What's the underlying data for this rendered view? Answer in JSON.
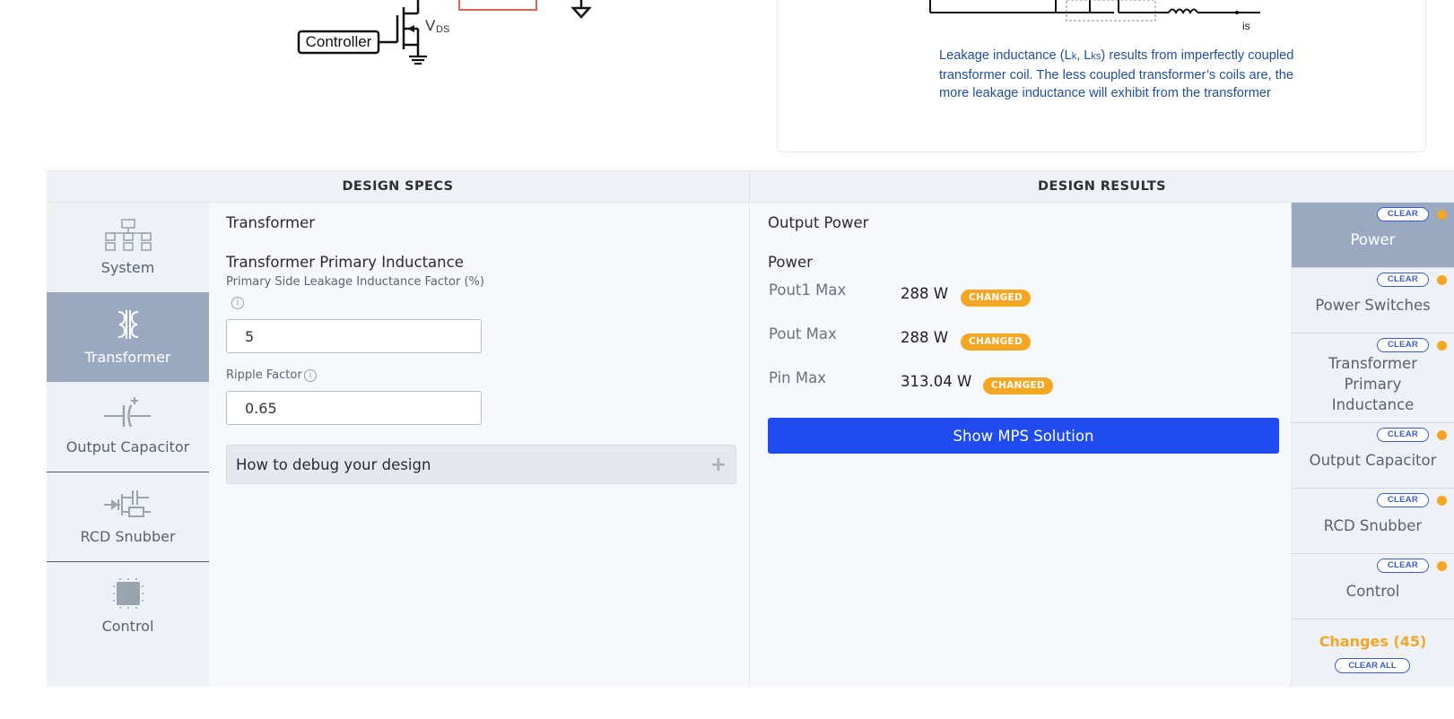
{
  "figure": {
    "left_schematic": {
      "controller_label": "Controller",
      "vds_main": "V",
      "vds_sub": "DS"
    },
    "leakage": {
      "is_label": "is",
      "text_part1": "Leakage inductance (",
      "lk_main": "L",
      "lk_sub": "k",
      "comma": ", ",
      "lks_main": "L",
      "lks_sub": "ks",
      "text_part2": ") results from imperfectly coupled transformer coil. The less coupled transformer’s coils are, the more leakage inductance will exhibit from the transformer"
    }
  },
  "headers": {
    "specs": "DESIGN SPECS",
    "results": "DESIGN RESULTS"
  },
  "left_nav": {
    "items": [
      {
        "label": "System",
        "icon": "system-blocks-icon"
      },
      {
        "label": "Transformer",
        "icon": "transformer-icon"
      },
      {
        "label": "Output Capacitor",
        "icon": "capacitor-icon"
      },
      {
        "label": "RCD Snubber",
        "icon": "rcd-snubber-icon"
      },
      {
        "label": "Control",
        "icon": "chip-icon"
      }
    ],
    "active": "Transformer"
  },
  "specs": {
    "title": "Transformer",
    "subtitle": "Transformer Primary Inductance",
    "leakage_label": "Primary Side Leakage Inductance Factor (%)",
    "leakage_value": "5",
    "ripple_label": "Ripple Factor",
    "ripple_value": "0.65",
    "info_glyph": "i",
    "debug_label": "How to debug your design",
    "debug_plus": "+"
  },
  "results": {
    "title": "Output Power",
    "subtitle": "Power",
    "rows": [
      {
        "name": "Pout1 Max",
        "value": "288 W",
        "badge": "CHANGED"
      },
      {
        "name": "Pout Max",
        "value": "288 W",
        "badge": "CHANGED"
      },
      {
        "name": "Pin Max",
        "value": "313.04 W",
        "badge": "CHANGED"
      }
    ],
    "button_label": "Show MPS Solution"
  },
  "right_nav": {
    "clear_label": "CLEAR",
    "items": [
      {
        "label": "Power"
      },
      {
        "label": "Power Switches"
      },
      {
        "label": "Transformer Primary Inductance"
      },
      {
        "label": "Output Capacitor"
      },
      {
        "label": "RCD Snubber"
      },
      {
        "label": "Control"
      }
    ],
    "active": "Power",
    "changes_label": "Changes (45)",
    "clear_all_label": "CLEAR ALL"
  },
  "colors": {
    "accent_blue": "#1f4bef",
    "changed_orange": "#f5a623",
    "nav_active": "#9aa9c0",
    "leakage_text": "#1f4e9c"
  }
}
